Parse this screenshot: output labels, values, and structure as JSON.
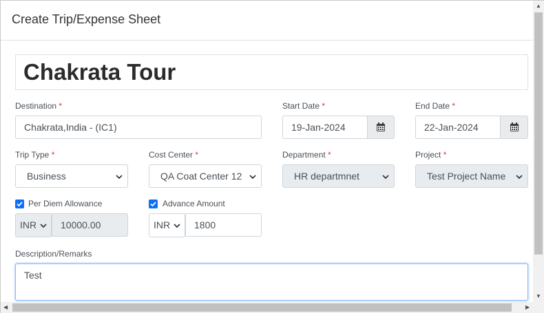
{
  "modal": {
    "title": "Create Trip/Expense Sheet"
  },
  "trip": {
    "name": "Chakrata Tour"
  },
  "destination": {
    "label": "Destination",
    "required": "*",
    "value": "Chakrata,India -  (IC1)"
  },
  "start_date": {
    "label": "Start Date",
    "required": "*",
    "value": "19-Jan-2024"
  },
  "end_date": {
    "label": "End Date",
    "required": "*",
    "value": "22-Jan-2024"
  },
  "trip_type": {
    "label": "Trip Type",
    "required": "*",
    "value": "Business"
  },
  "cost_center": {
    "label": "Cost Center",
    "required": "*",
    "value": "QA Coat Center 12"
  },
  "department": {
    "label": "Department",
    "required": "*",
    "value": "HR departmnet"
  },
  "project": {
    "label": "Project",
    "required": "*",
    "value": "Test Project Name"
  },
  "per_diem": {
    "label": "Per Diem Allowance",
    "checked": true,
    "currency": "INR",
    "amount": "10000.00"
  },
  "advance": {
    "label": "Advance Amount",
    "checked": true,
    "currency": "INR",
    "amount": "1800"
  },
  "description": {
    "label": "Description/Remarks",
    "value": "Test"
  },
  "colors": {
    "accent": "#0d6efd",
    "required": "#dc3545",
    "readonly_bg": "#e9ecef"
  }
}
